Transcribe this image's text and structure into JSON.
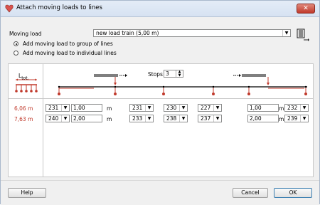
{
  "window": {
    "title": "Attach moving loads to lines"
  },
  "moving_load": {
    "label": "Moving load",
    "selected": "new load train (5,00 m)"
  },
  "options": {
    "group": "Add moving load to group of lines",
    "individual": "Add moving load to individual lines",
    "selected": "group"
  },
  "stops": {
    "label": "Stops",
    "value": "3"
  },
  "ltot_label": "L",
  "ltot_sub": "tot.",
  "rows": [
    {
      "length": "6,06 m",
      "c1": "231",
      "d1": "1,00",
      "u1": "m",
      "c2": "231",
      "c3": "230",
      "c4": "227",
      "d2": "1,00",
      "u2": "m",
      "c5": "232"
    },
    {
      "length": "7,63 m",
      "c1": "240",
      "d1": "2,00",
      "u1": "m",
      "c2": "233",
      "c3": "238",
      "c4": "237",
      "d2": "2,00",
      "u2": "m",
      "c5": "239"
    }
  ],
  "buttons": {
    "help": "Help",
    "cancel": "Cancel",
    "ok": "OK"
  },
  "colors": {
    "accent_red": "#c0392b",
    "titlebar": "#dbe5f1"
  }
}
